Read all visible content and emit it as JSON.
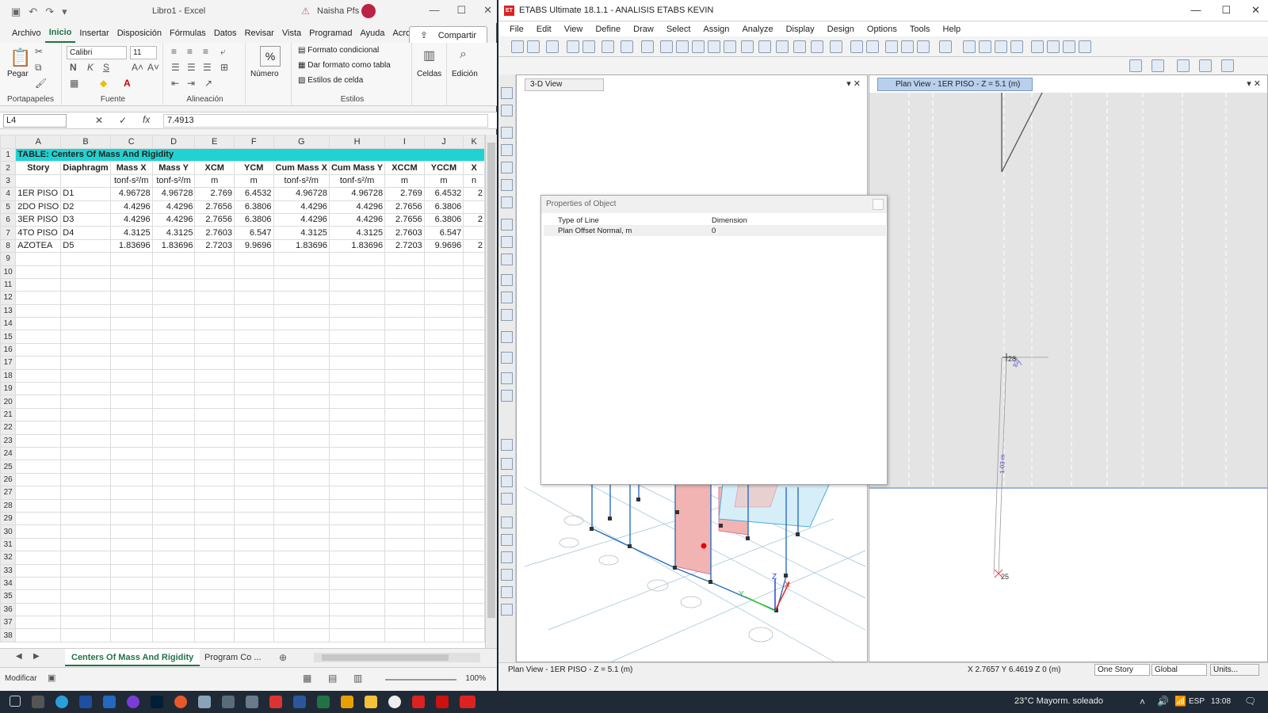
{
  "excel": {
    "title": "Libro1 - Excel",
    "user": "Naisha Pfs",
    "tabs": [
      "Archivo",
      "Inicio",
      "Insertar",
      "Disposición",
      "Fórmulas",
      "Datos",
      "Revisar",
      "Vista",
      "Programad",
      "Ayuda",
      "Acrobat"
    ],
    "share_label": "Compartir",
    "ribbon": {
      "paste_label": "Pegar",
      "font_name": "Calibri",
      "font_size": "11",
      "numero_label": "Número",
      "cond_format": "Formato condicional",
      "table_format": "Dar formato como tabla",
      "cell_styles": "Estilos de celda",
      "celdas_label": "Celdas",
      "edicion_label": "Edición",
      "groups": [
        "Portapapeles",
        "Fuente",
        "Alineación",
        "Estilos"
      ]
    },
    "name_box": "L4",
    "formula_value": "7.4913",
    "fx_label": "fx",
    "col_headers": [
      "A",
      "B",
      "C",
      "D",
      "E",
      "F",
      "G",
      "H",
      "I",
      "J",
      "K"
    ],
    "table_title": "TABLE:  Centers Of Mass And Rigidity",
    "headers": [
      "Story",
      "Diaphragm",
      "Mass X",
      "Mass Y",
      "XCM",
      "YCM",
      "Cum Mass X",
      "Cum Mass Y",
      "XCCM",
      "YCCM",
      "X"
    ],
    "units": [
      "",
      "",
      "tonf-s²/m",
      "tonf-s²/m",
      "m",
      "m",
      "tonf-s²/m",
      "tonf-s²/m",
      "m",
      "m",
      "n"
    ],
    "rows": [
      [
        "1ER PISO",
        "D1",
        "4.96728",
        "4.96728",
        "2.769",
        "6.4532",
        "4.96728",
        "4.96728",
        "2.769",
        "6.4532",
        "2"
      ],
      [
        "2DO PISO",
        "D2",
        "4.4296",
        "4.4296",
        "2.7656",
        "6.3806",
        "4.4296",
        "4.4296",
        "2.7656",
        "6.3806",
        ""
      ],
      [
        "3ER PISO",
        "D3",
        "4.4296",
        "4.4296",
        "2.7656",
        "6.3806",
        "4.4296",
        "4.4296",
        "2.7656",
        "6.3806",
        "2"
      ],
      [
        "4TO PISO",
        "D4",
        "4.3125",
        "4.3125",
        "2.7603",
        "6.547",
        "4.3125",
        "4.3125",
        "2.7603",
        "6.547",
        ""
      ],
      [
        "AZOTEA",
        "D5",
        "1.83696",
        "1.83696",
        "2.7203",
        "9.9696",
        "1.83696",
        "1.83696",
        "2.7203",
        "9.9696",
        "2"
      ]
    ],
    "sheet_tabs": [
      "Centers Of Mass And Rigidity",
      "Program Co ..."
    ],
    "status_mode": "Modificar",
    "zoom": "100%"
  },
  "etabs": {
    "title": "ETABS Ultimate 18.1.1 - ANALISIS ETABS KEVIN",
    "logo": "ET",
    "menu": [
      "File",
      "Edit",
      "View",
      "Define",
      "Draw",
      "Select",
      "Assign",
      "Analyze",
      "Display",
      "Design",
      "Options",
      "Tools",
      "Help"
    ],
    "view3d_tab": "3-D View",
    "plan_tab": "Plan View - 1ER PISO - Z = 5.1 (m)",
    "dialog": {
      "title": "Properties of Object",
      "rows": [
        {
          "label": "Type of Line",
          "value": "Dimension"
        },
        {
          "label": "Plan Offset Normal, m",
          "value": "0"
        }
      ]
    },
    "plan_labels": {
      "p28": "28",
      "p25": "25",
      "dim": "1.03 m",
      "angle": "82°"
    },
    "status_left": "Plan View - 1ER PISO - Z = 5.1 (m)",
    "status_coord": "X 2.7657  Y 6.4619  Z 0 (m)",
    "status_story": "One Story",
    "status_global": "Global",
    "status_units": "Units..."
  },
  "taskbar": {
    "weather": "23°C  Mayorm. soleado",
    "lang": "ESP",
    "time": "13:08"
  }
}
